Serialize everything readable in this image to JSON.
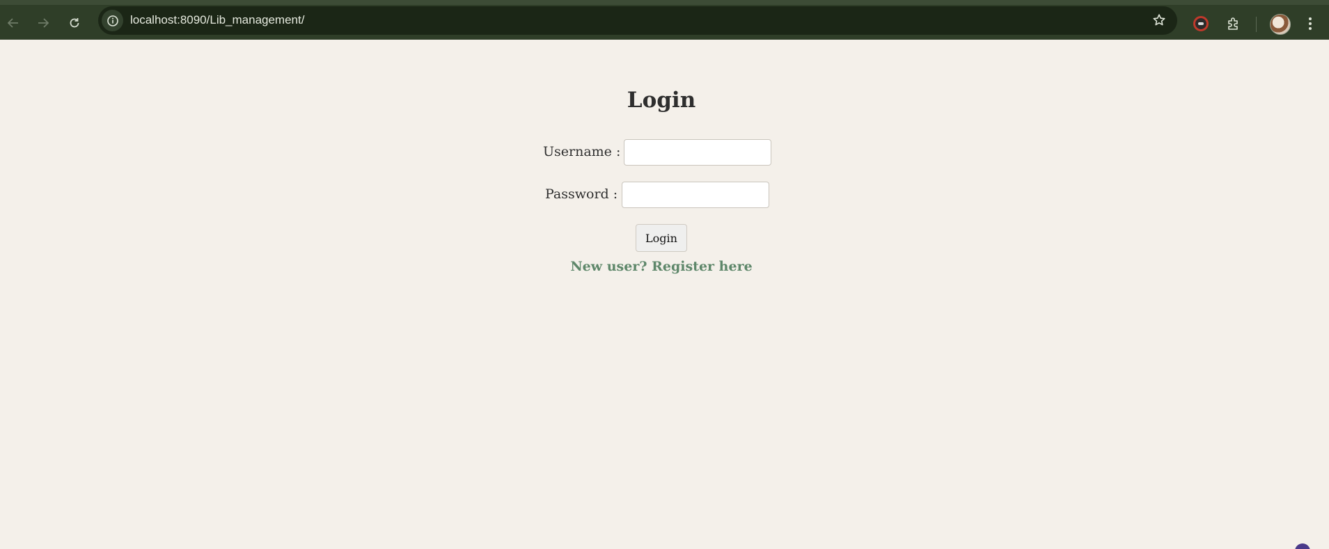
{
  "browser": {
    "url": "localhost:8090/Lib_management/",
    "colors": {
      "chrome_bg": "#2f3e28",
      "omnibox_bg": "#1b2616",
      "url_text": "#e6eadf"
    }
  },
  "page": {
    "title": "Login",
    "username_label": "Username :",
    "password_label": "Password :",
    "username_value": "",
    "password_value": "",
    "login_button": "Login",
    "register_link": "New user? Register here",
    "colors": {
      "background": "#f4f0ea",
      "text": "#2e2e2e",
      "link": "#5e876a"
    }
  },
  "icons": {
    "back": "arrow-left-icon",
    "forward": "arrow-right-icon",
    "reload": "reload-icon",
    "site_info": "info-icon",
    "bookmark": "star-icon",
    "extension": "extension-icon",
    "extensions_menu": "puzzle-icon",
    "profile": "avatar",
    "menu": "kebab-menu-icon"
  }
}
